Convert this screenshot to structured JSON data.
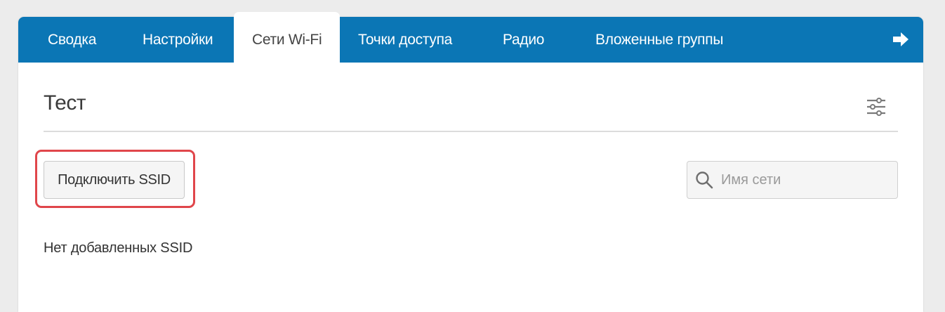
{
  "tabs": [
    {
      "label": "Сводка"
    },
    {
      "label": "Настройки"
    },
    {
      "label": "Сети Wi-Fi",
      "active": true
    },
    {
      "label": "Точки доступа"
    },
    {
      "label": "Радио"
    },
    {
      "label": "Вложенные группы"
    }
  ],
  "nav": {
    "next_icon": "arrow-right-icon"
  },
  "group": {
    "title": "Тест",
    "settings_icon": "sliders-icon"
  },
  "actions": {
    "connect_ssid_label": "Подключить SSID"
  },
  "search": {
    "placeholder": "Имя сети",
    "value": "",
    "icon": "search-icon"
  },
  "list": {
    "empty_text": "Нет добавленных SSID"
  },
  "colors": {
    "accent": "#0b76b5",
    "highlight": "#e0464b",
    "background": "#ececec"
  }
}
